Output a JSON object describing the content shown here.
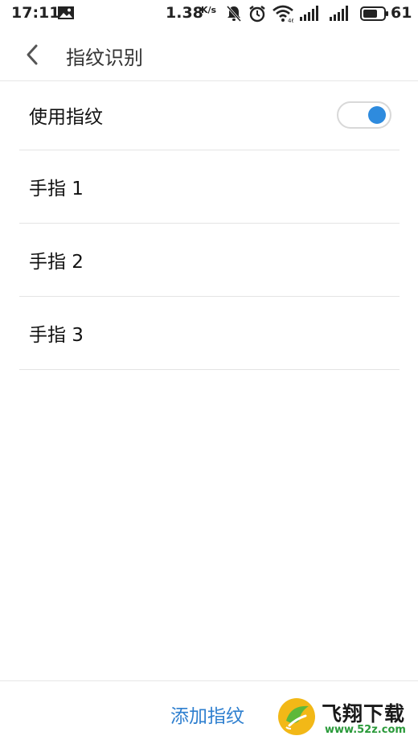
{
  "status_bar": {
    "time": "17:11",
    "network_speed": "1.38",
    "network_speed_unit": "K/s",
    "battery_level": "61",
    "icons": [
      "image-notification-icon",
      "mute-icon",
      "alarm-icon",
      "wifi-icon",
      "signal-icon",
      "signal-icon",
      "battery-icon"
    ]
  },
  "header": {
    "title": "指纹识别",
    "back_icon": "back-arrow-icon"
  },
  "settings": {
    "use_fingerprint_label": "使用指纹",
    "use_fingerprint_enabled": true,
    "fingers": [
      {
        "label": "手指 1"
      },
      {
        "label": "手指 2"
      },
      {
        "label": "手指 3"
      }
    ]
  },
  "bottom": {
    "add_fingerprint_label": "添加指纹"
  },
  "watermark": {
    "name": "飞翔下载",
    "url": "www.52z.com"
  },
  "colors": {
    "accent": "#2e8bde",
    "link": "#2e7fcf",
    "divider": "#e4e4e4"
  }
}
